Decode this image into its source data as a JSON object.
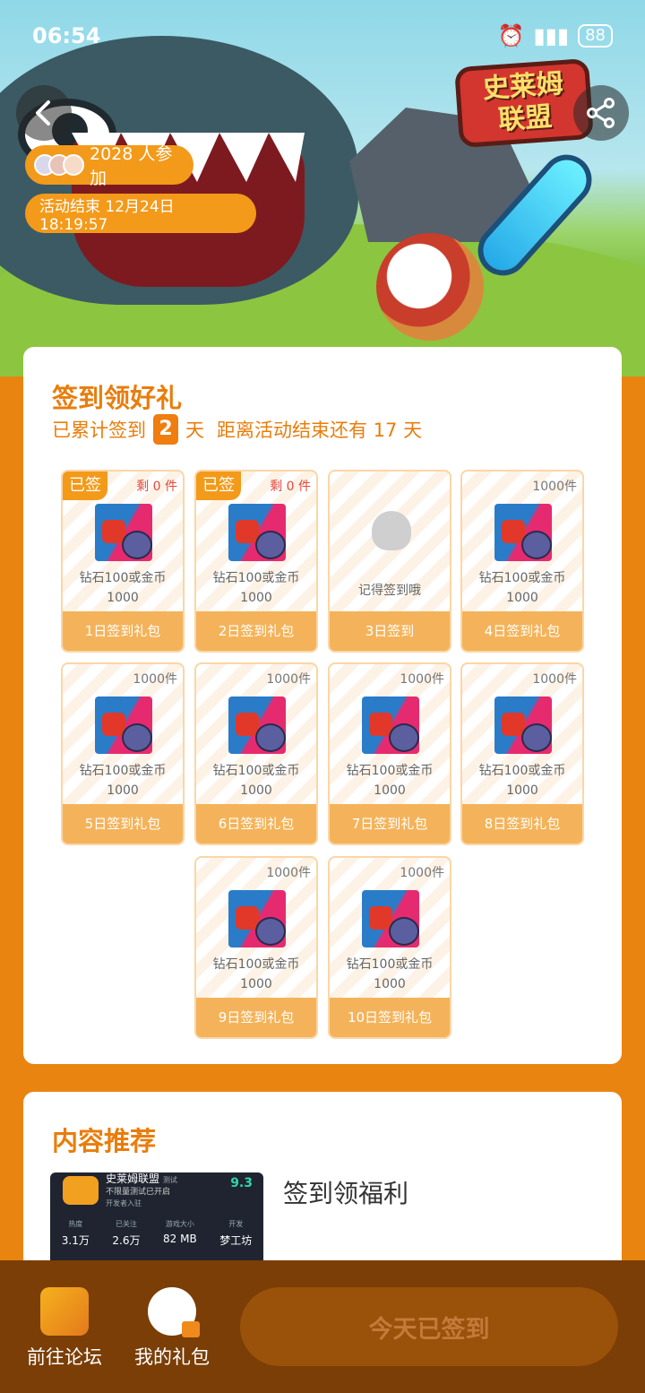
{
  "status_bar": {
    "time": "06:54",
    "battery": "88"
  },
  "banner": {
    "logo_line1": "史莱姆",
    "logo_line2": "联盟"
  },
  "participants": {
    "text": "2028 人参加"
  },
  "event_end": {
    "text": "活动结束 12月24日 18:19:57"
  },
  "checkin": {
    "title": "签到领好礼",
    "accum_prefix": "已累计签到",
    "days_signed": "2",
    "day_unit": "天",
    "remaining_text": "距离活动结束还有 17 天",
    "tiles": [
      {
        "badge": "已签",
        "remain": "剩 0 件",
        "desc1": "钻石100或金币",
        "desc2": "1000",
        "label": "1日签到礼包"
      },
      {
        "badge": "已签",
        "remain": "剩 0 件",
        "desc1": "钻石100或金币",
        "desc2": "1000",
        "label": "2日签到礼包"
      },
      {
        "remind": "记得签到哦",
        "label": "3日签到"
      },
      {
        "stock": "1000件",
        "desc1": "钻石100或金币",
        "desc2": "1000",
        "label": "4日签到礼包"
      },
      {
        "stock": "1000件",
        "desc1": "钻石100或金币",
        "desc2": "1000",
        "label": "5日签到礼包"
      },
      {
        "stock": "1000件",
        "desc1": "钻石100或金币",
        "desc2": "1000",
        "label": "6日签到礼包"
      },
      {
        "stock": "1000件",
        "desc1": "钻石100或金币",
        "desc2": "1000",
        "label": "7日签到礼包"
      },
      {
        "stock": "1000件",
        "desc1": "钻石100或金币",
        "desc2": "1000",
        "label": "8日签到礼包"
      },
      {
        "stock": "1000件",
        "desc1": "钻石100或金币",
        "desc2": "1000",
        "label": "9日签到礼包"
      },
      {
        "stock": "1000件",
        "desc1": "钻石100或金币",
        "desc2": "1000",
        "label": "10日签到礼包"
      }
    ]
  },
  "recommend": {
    "title": "内容推荐",
    "item_title": "签到领福利",
    "thumb": {
      "game_name": "史莱姆联盟",
      "tag": "测试",
      "subtitle": "不限量测试已开启",
      "sub2": "开发者入驻",
      "score": "9.3",
      "stats": [
        {
          "k": "热度",
          "v": "3.1万"
        },
        {
          "k": "已关注",
          "v": "2.6万"
        },
        {
          "k": "游戏大小",
          "v": "82 MB"
        },
        {
          "k": "开发",
          "v": "梦工坊"
        }
      ]
    }
  },
  "bottom_bar": {
    "forum_label": "前往论坛",
    "gifts_label": "我的礼包",
    "checkin_button": "今天已签到"
  }
}
